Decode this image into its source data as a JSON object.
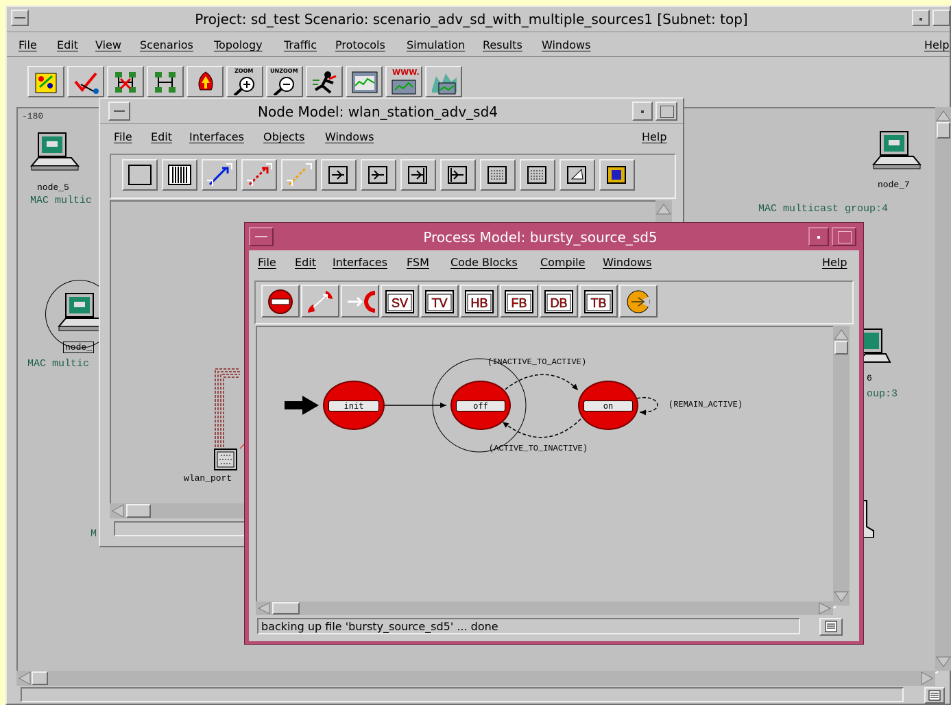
{
  "project_window": {
    "title": "Project: sd_test Scenario: scenario_adv_sd_with_multiple_sources1   [Subnet: top]",
    "menu": [
      "File",
      "Edit",
      "View",
      "Scenarios",
      "Topology",
      "Traffic",
      "Protocols",
      "Simulation",
      "Results",
      "Windows"
    ],
    "help": "Help",
    "toolbar_icons": [
      "object-palette-icon",
      "check-links-icon",
      "fail-node-icon",
      "recover-node-icon",
      "return-to-parent-icon",
      "zoom-icon",
      "unzoom-icon",
      "run-simulation-icon",
      "view-results-icon",
      "web-report-icon",
      "hide-graphs-icon"
    ],
    "zoom_label": "ZOOM",
    "unzoom_label": "UNZOOM",
    "www_label": "WWW.",
    "ruler_value": "-180",
    "nodes": {
      "node_5": "node_5",
      "node_7": "node_7",
      "node_partial": "node_",
      "node_6_partial": "6"
    },
    "labels": {
      "mac_multi_1": "MAC multic",
      "mac_multi_2": "MAC multic",
      "mac_group_4": "MAC multicast group:4",
      "mac_group_3": "oup:3",
      "mac_partial_m": "M"
    }
  },
  "node_window": {
    "title": "Node Model: wlan_station_adv_sd4",
    "menu": [
      "File",
      "Edit",
      "Interfaces",
      "Objects",
      "Windows"
    ],
    "help": "Help",
    "toolbar_icons": [
      "node-icon",
      "bus-icon",
      "packet-stream-icon",
      "statistic-wire-icon",
      "logical-association-icon",
      "point-to-point-tx-icon",
      "point-to-point-rx-icon",
      "bus-tx-icon",
      "bus-rx-icon",
      "radio-tx-icon",
      "radio-rx-icon",
      "antenna-icon",
      "module-icon"
    ],
    "module_label": "wlan_port"
  },
  "process_window": {
    "title": "Process Model: bursty_source_sd5",
    "menu": [
      "File",
      "Edit",
      "Interfaces",
      "FSM",
      "Code Blocks",
      "Compile",
      "Windows"
    ],
    "help": "Help",
    "toolbar_icons": [
      "create-state-icon",
      "create-transition-icon",
      "set-initial-state-icon",
      "state-variables-icon",
      "temporary-variables-icon",
      "header-block-icon",
      "function-block-icon",
      "diagnostic-block-icon",
      "termination-block-icon",
      "compile-icon"
    ],
    "toolbar_text": [
      "SV",
      "TV",
      "HB",
      "FB",
      "DB",
      "TB"
    ],
    "states": [
      "init",
      "off",
      "on"
    ],
    "transitions": {
      "inactive_to_active": "(INACTIVE_TO_ACTIVE)",
      "active_to_inactive": "(ACTIVE_TO_INACTIVE)",
      "remain_active": "(REMAIN_ACTIVE)"
    },
    "status": "backing up file 'bursty_source_sd5' ... done"
  },
  "colors": {
    "process_frame": "#b84c72",
    "state_fill": "#e00000",
    "desktop_bg": "#ffffc8",
    "window_gray": "#c8c8c8"
  }
}
